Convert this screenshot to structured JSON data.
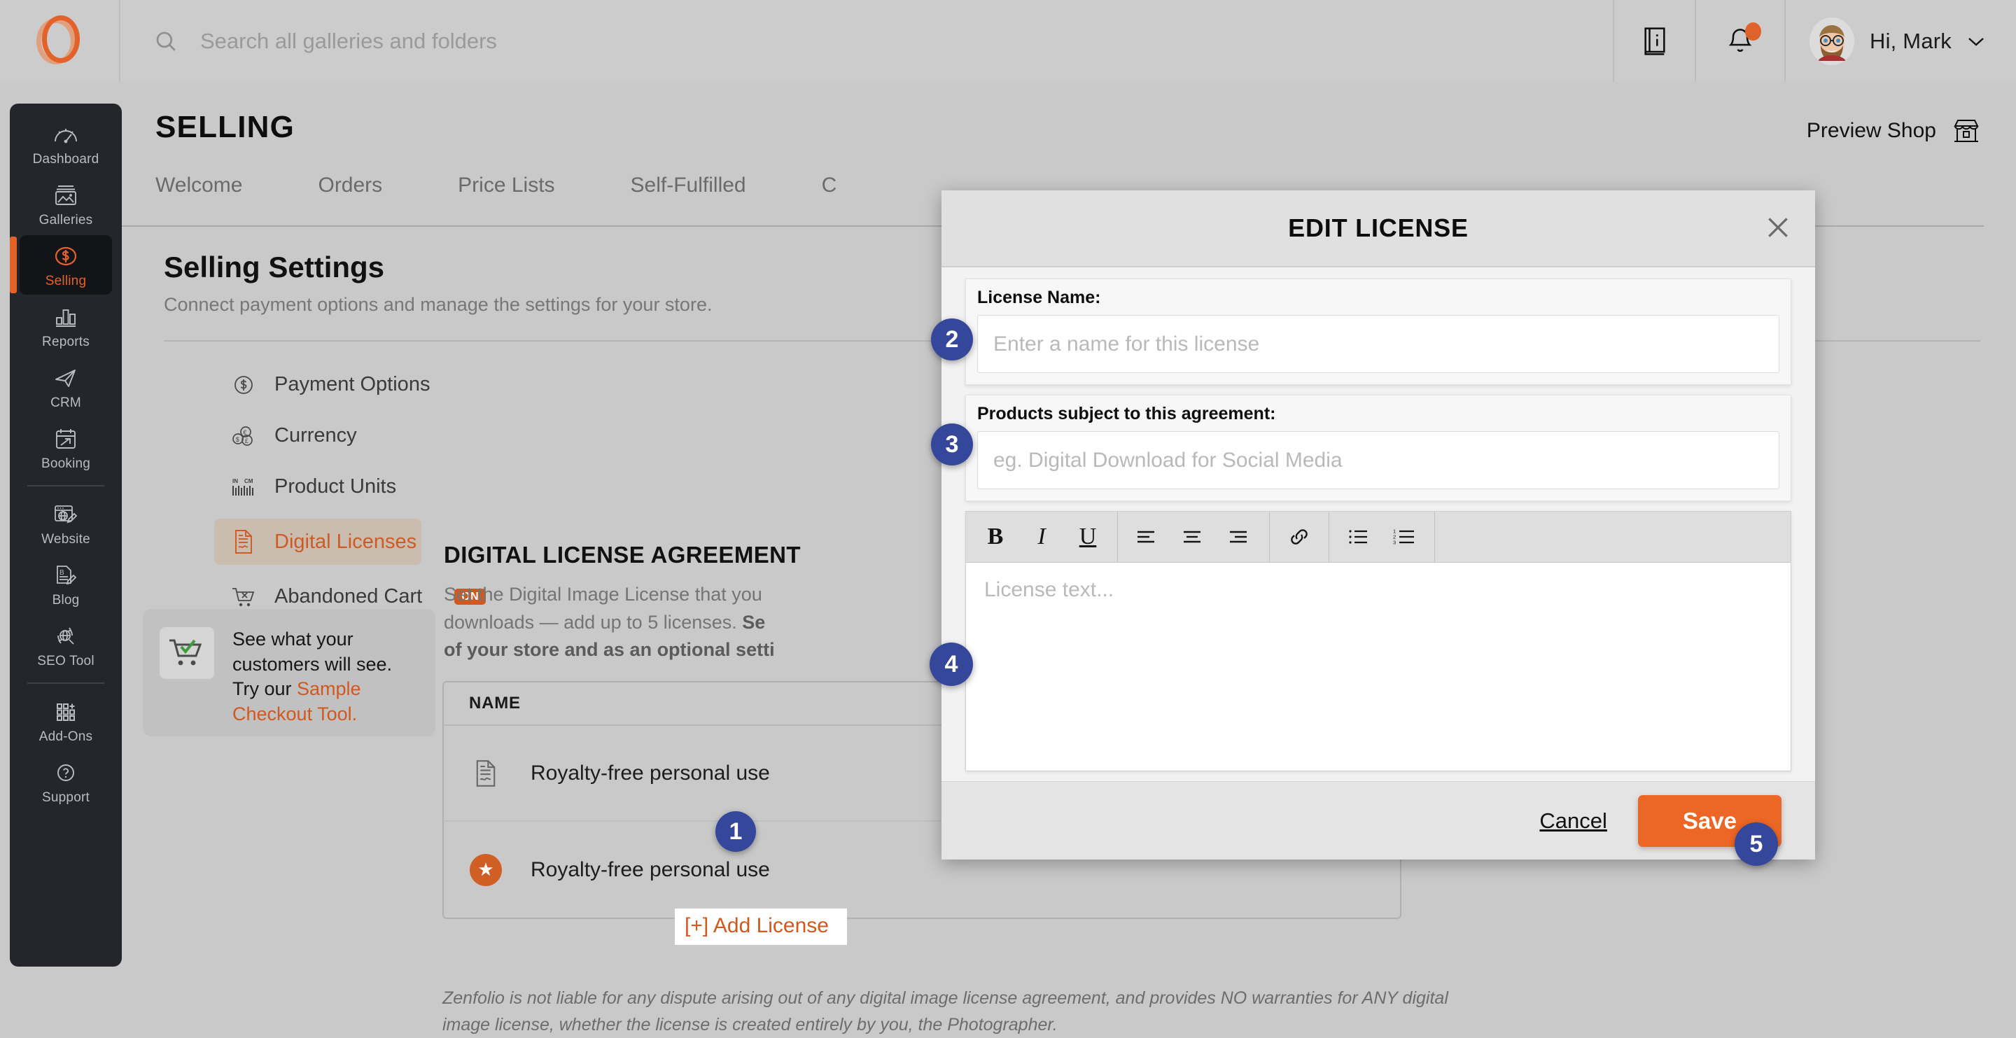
{
  "header": {
    "logo_icon": "zenfolio-logo-icon",
    "search": {
      "icon": "search-icon",
      "placeholder": "Search all galleries and folders",
      "value": ""
    },
    "help_icon": "book-info-icon",
    "notifications_icon": "bell-icon",
    "avatar_icon": "user-avatar",
    "greeting": "Hi, Mark",
    "chevron_icon": "chevron-down-icon"
  },
  "sidebar": {
    "items": [
      {
        "label": "Dashboard",
        "icon": "gauge-icon",
        "active": false
      },
      {
        "label": "Galleries",
        "icon": "photo-stack-icon",
        "active": false
      },
      {
        "label": "Selling",
        "icon": "dollar-circle-icon",
        "active": true
      },
      {
        "label": "Reports",
        "icon": "bar-chart-icon",
        "active": false
      },
      {
        "label": "CRM",
        "icon": "paper-plane-icon",
        "active": false
      },
      {
        "label": "Booking",
        "icon": "calendar-arrow-icon",
        "active": false
      },
      {
        "label": "Website",
        "icon": "browser-pencil-icon",
        "active": false
      },
      {
        "label": "Blog",
        "icon": "document-pencil-icon",
        "active": false
      },
      {
        "label": "SEO Tool",
        "icon": "globe-search-icon",
        "active": false
      },
      {
        "label": "Add-Ons",
        "icon": "grid-plus-icon",
        "active": false
      },
      {
        "label": "Support",
        "icon": "question-circle-icon",
        "active": false
      }
    ]
  },
  "main": {
    "page_title": "SELLING",
    "preview_shop": {
      "label": "Preview Shop",
      "icon": "storefront-icon"
    },
    "tabs": [
      {
        "label": "Welcome"
      },
      {
        "label": "Orders"
      },
      {
        "label": "Price Lists"
      },
      {
        "label": "Self-Fulfilled"
      },
      {
        "label": "C"
      }
    ],
    "section_title": "Selling Settings",
    "section_subtitle": "Connect payment options and manage the settings for your store.",
    "settings_items": [
      {
        "label": "Payment Options",
        "icon": "dollar-circle-icon",
        "active": false,
        "badge": ""
      },
      {
        "label": "Currency",
        "icon": "coins-icon",
        "active": false,
        "badge": ""
      },
      {
        "label": "Product Units",
        "icon": "ruler-units-icon",
        "active": false,
        "badge": ""
      },
      {
        "label": "Digital Licenses",
        "icon": "license-document-icon",
        "active": true,
        "badge": ""
      },
      {
        "label": "Abandoned Cart",
        "icon": "cart-x-icon",
        "active": false,
        "badge": "ON"
      }
    ],
    "promo": {
      "icon": "cart-check-icon",
      "line1": "See what your",
      "line2": "customers will see.",
      "line3_prefix": "Try our ",
      "link1": "Sample",
      "link2": "Checkout Tool."
    },
    "agreement": {
      "title": "DIGITAL LICENSE AGREEMENT",
      "desc_part1": "Set the Digital Image License that you",
      "desc_part2": "downloads — add up to 5 licenses. ",
      "desc_bold1": "Se",
      "desc_bold2": "of your store and as an optional setti"
    },
    "license_table": {
      "column_header": "NAME",
      "rows": [
        {
          "name": "Royalty-free personal use",
          "icon": "license-document-icon"
        },
        {
          "name": "Royalty-free personal use",
          "icon": "star-badge-icon"
        }
      ]
    },
    "add_license_label": "[+] Add License",
    "disclaimer": "Zenfolio is not liable for any dispute arising out of any digital image license agreement, and provides NO warranties for ANY digital image license, whether the license is created entirely by you, the Photographer."
  },
  "dialog": {
    "title": "EDIT LICENSE",
    "close_icon": "close-icon",
    "license_name": {
      "label": "License Name:",
      "placeholder": "Enter a name for this license",
      "value": ""
    },
    "products": {
      "label": "Products subject to this agreement:",
      "placeholder": "eg. Digital Download for Social Media",
      "value": ""
    },
    "toolbar": [
      {
        "name": "bold",
        "glyph": "B"
      },
      {
        "name": "italic",
        "glyph": "I"
      },
      {
        "name": "underline",
        "glyph": "U"
      },
      {
        "name": "align-left",
        "glyph": ""
      },
      {
        "name": "align-center",
        "glyph": ""
      },
      {
        "name": "align-right",
        "glyph": ""
      },
      {
        "name": "link",
        "glyph": ""
      },
      {
        "name": "bullet-list",
        "glyph": ""
      },
      {
        "name": "numbered-list",
        "glyph": ""
      }
    ],
    "editor_placeholder": "License text...",
    "cancel_label": "Cancel",
    "save_label": "Save"
  },
  "steps": {
    "s1": "1",
    "s2": "2",
    "s3": "3",
    "s4": "4",
    "s5": "5"
  },
  "colors": {
    "accent": "#e2622a",
    "save_button": "#ec6625",
    "step_bubble": "#35479b",
    "sidebar_bg": "#24262b"
  }
}
